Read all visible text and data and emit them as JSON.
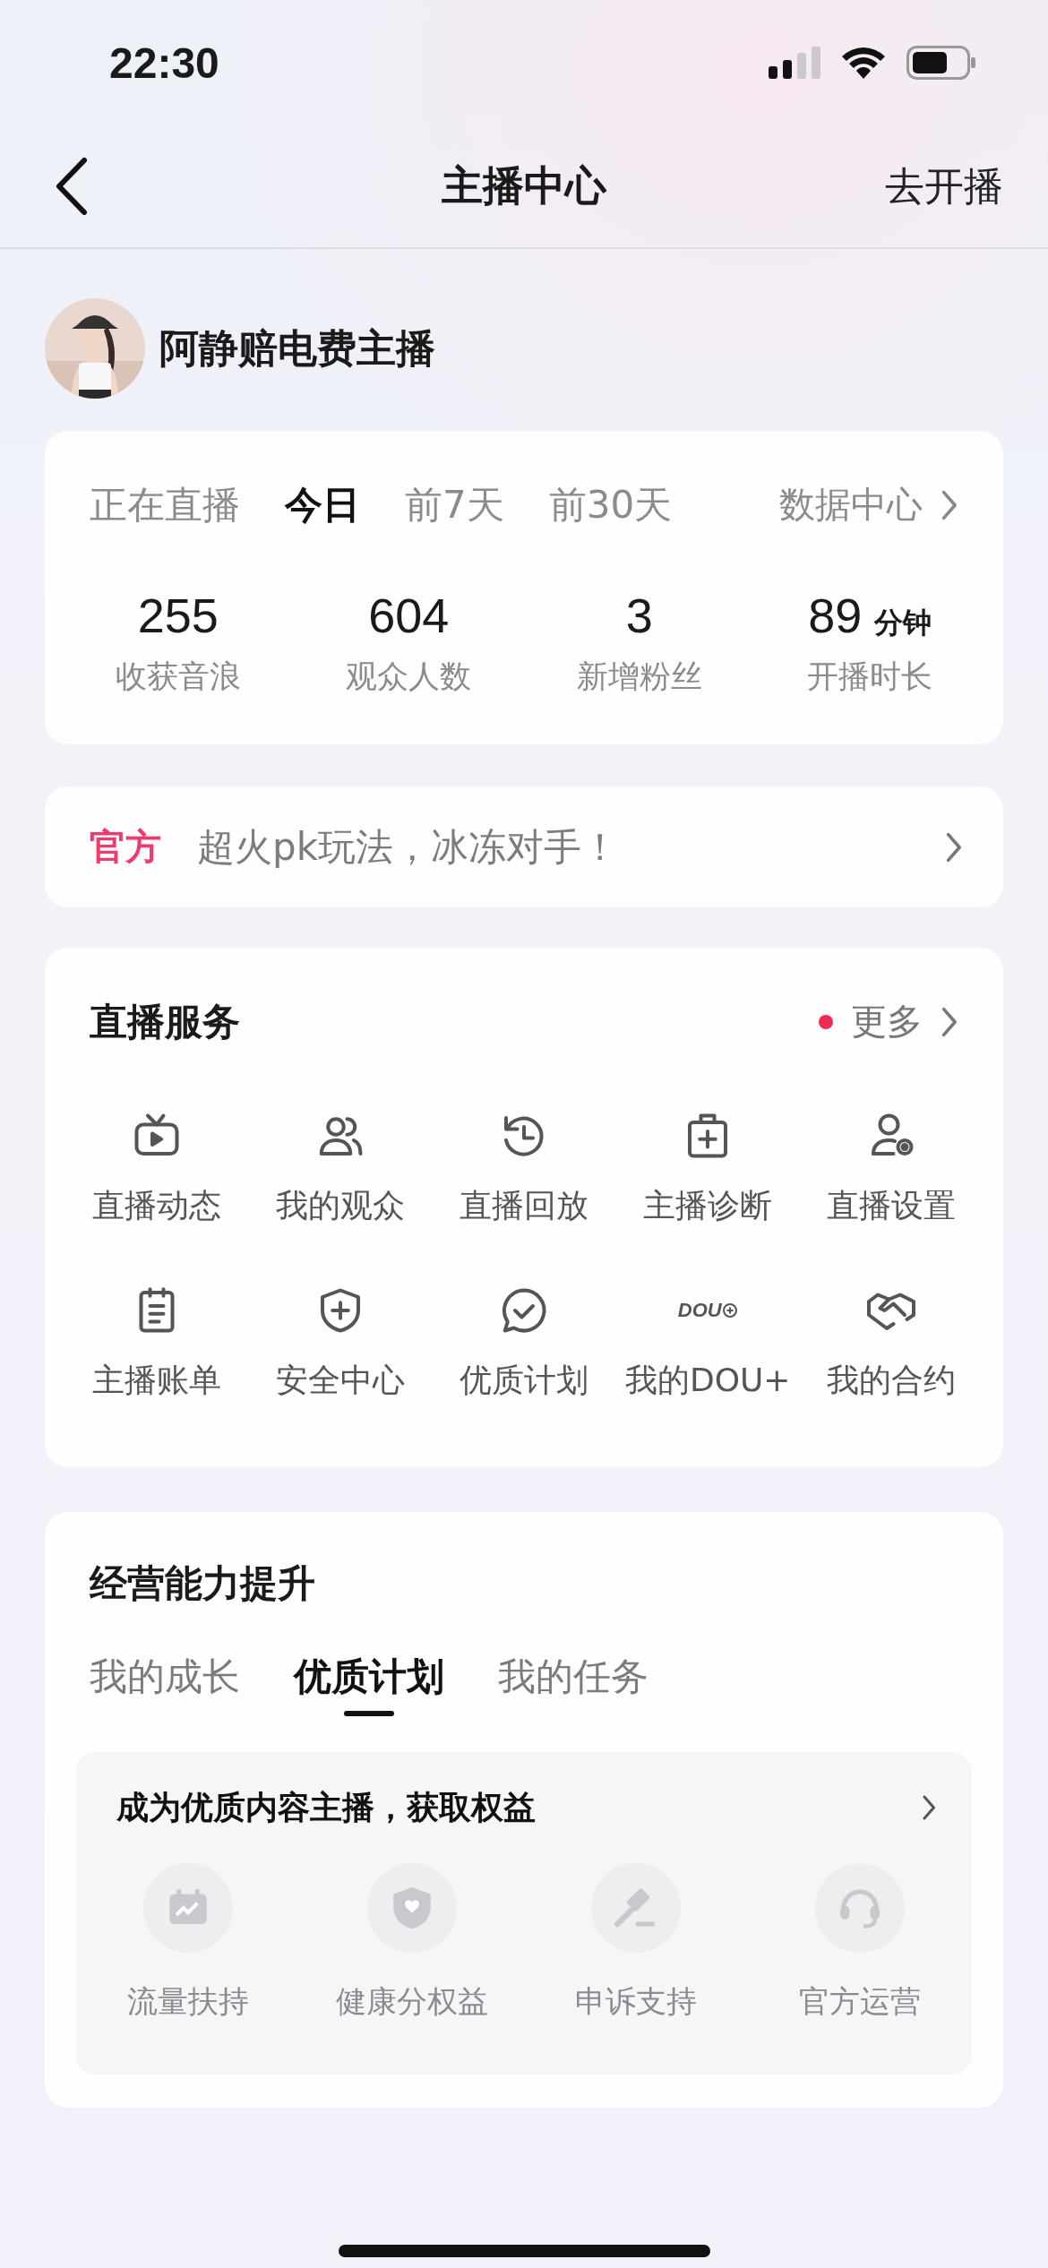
{
  "status_bar": {
    "time": "22:30"
  },
  "nav": {
    "title": "主播中心",
    "action": "去开播"
  },
  "profile": {
    "name": "阿静赔电费主播"
  },
  "stats": {
    "tabs": [
      {
        "label": "正在直播",
        "selected": false
      },
      {
        "label": "今日",
        "selected": true
      },
      {
        "label": "前7天",
        "selected": false
      },
      {
        "label": "前30天",
        "selected": false
      }
    ],
    "link": "数据中心",
    "metrics": [
      {
        "value": "255",
        "label": "收获音浪"
      },
      {
        "value": "604",
        "label": "观众人数"
      },
      {
        "value": "3",
        "label": "新增粉丝"
      },
      {
        "value": "89",
        "unit": "分钟",
        "label": "开播时长"
      }
    ]
  },
  "banner": {
    "tag": "官方",
    "text": "超火pk玩法，冰冻对手！"
  },
  "services": {
    "title": "直播服务",
    "more": "更多",
    "more_dot": true,
    "items": [
      {
        "label": "直播动态"
      },
      {
        "label": "我的观众"
      },
      {
        "label": "直播回放"
      },
      {
        "label": "主播诊断"
      },
      {
        "label": "直播设置"
      },
      {
        "label": "主播账单"
      },
      {
        "label": "安全中心"
      },
      {
        "label": "优质计划"
      },
      {
        "label": "我的DOU+",
        "icon_text": "DOU"
      },
      {
        "label": "我的合约"
      }
    ]
  },
  "growth": {
    "title": "经营能力提升",
    "tabs": [
      {
        "label": "我的成长",
        "selected": false
      },
      {
        "label": "优质计划",
        "selected": true
      },
      {
        "label": "我的任务",
        "selected": false
      }
    ],
    "card": {
      "heading": "成为优质内容主播，获取权益",
      "benefits": [
        {
          "label": "流量扶持"
        },
        {
          "label": "健康分权益"
        },
        {
          "label": "申诉支持"
        },
        {
          "label": "官方运营"
        }
      ]
    }
  }
}
